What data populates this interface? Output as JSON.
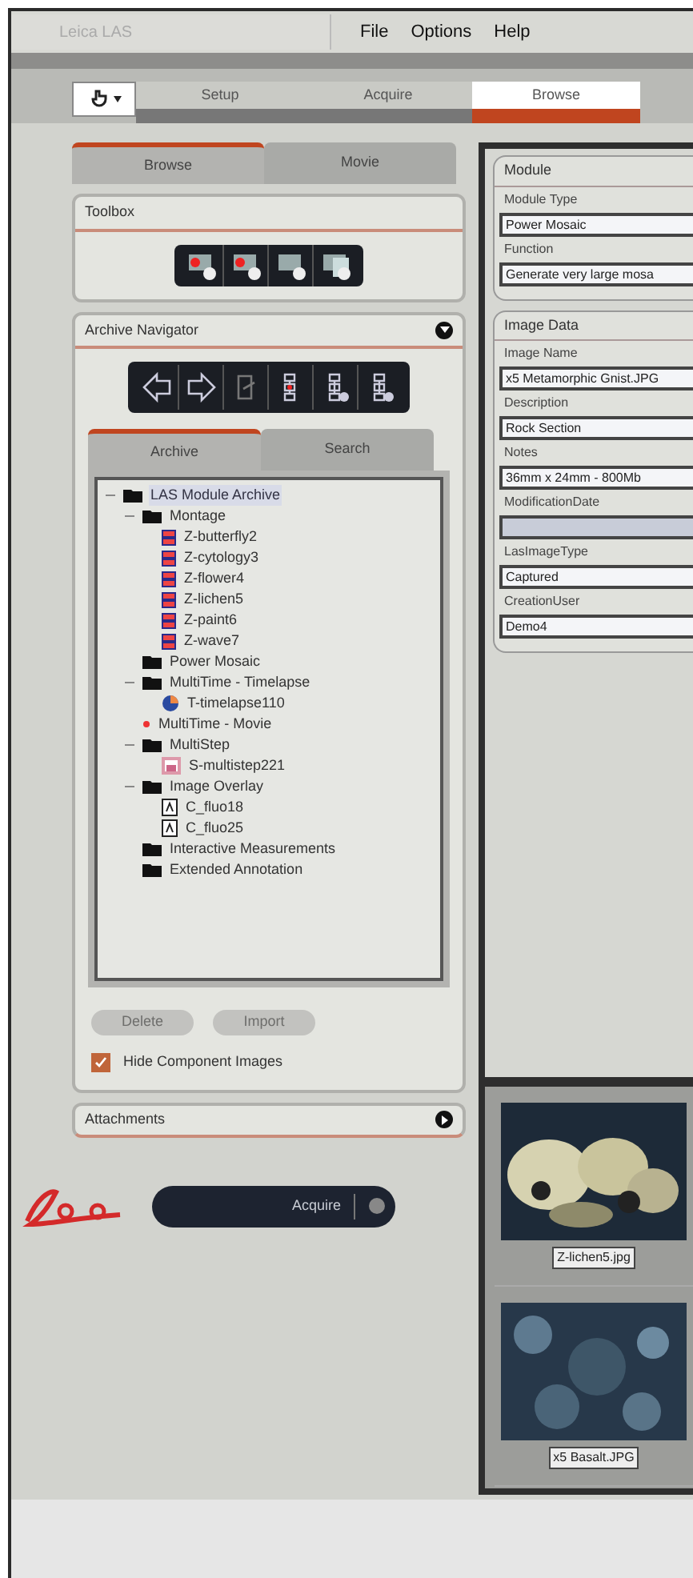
{
  "window": {
    "title": "Leica LAS",
    "menu": [
      "File",
      "Options",
      "Help"
    ]
  },
  "workflow_tabs": [
    {
      "label": "Setup",
      "selected": false
    },
    {
      "label": "Acquire",
      "selected": false
    },
    {
      "label": "Browse",
      "selected": true
    }
  ],
  "left_tabs": [
    {
      "label": "Browse",
      "selected": true
    },
    {
      "label": "Movie",
      "selected": false
    }
  ],
  "toolbox": {
    "title": "Toolbox"
  },
  "archive_navigator": {
    "title": "Archive Navigator",
    "expanded": true,
    "tabs": [
      {
        "label": "Archive",
        "selected": true
      },
      {
        "label": "Search",
        "selected": false
      }
    ],
    "tree": [
      {
        "label": "LAS Module Archive",
        "kind": "archive",
        "expanded": true,
        "selected": true,
        "children": [
          {
            "label": "Montage",
            "kind": "folder",
            "expanded": true,
            "selected": false,
            "children": [
              {
                "label": "Z-butterfly2",
                "kind": "montage",
                "selected": false
              },
              {
                "label": "Z-cytology3",
                "kind": "montage",
                "selected": false
              },
              {
                "label": "Z-flower4",
                "kind": "montage",
                "selected": false
              },
              {
                "label": "Z-lichen5",
                "kind": "montage",
                "selected": false
              },
              {
                "label": "Z-paint6",
                "kind": "montage",
                "selected": false
              },
              {
                "label": "Z-wave7",
                "kind": "montage",
                "selected": false
              }
            ]
          },
          {
            "label": "Power Mosaic",
            "kind": "folder",
            "selected": false
          },
          {
            "label": "MultiTime - Timelapse",
            "kind": "folder",
            "expanded": true,
            "selected": false,
            "children": [
              {
                "label": "T-timelapse110",
                "kind": "timelapse",
                "selected": false
              }
            ]
          },
          {
            "label": "MultiTime - Movie",
            "kind": "movie",
            "selected": false
          },
          {
            "label": "MultiStep",
            "kind": "folder",
            "expanded": true,
            "selected": false,
            "children": [
              {
                "label": "S-multistep221",
                "kind": "multistep",
                "selected": false
              }
            ]
          },
          {
            "label": "Image Overlay",
            "kind": "folder",
            "expanded": true,
            "selected": false,
            "children": [
              {
                "label": "C_fluo18",
                "kind": "overlay",
                "selected": false
              },
              {
                "label": "C_fluo25",
                "kind": "overlay",
                "selected": false
              }
            ]
          },
          {
            "label": "Interactive Measurements",
            "kind": "folder",
            "selected": false
          },
          {
            "label": "Extended Annotation",
            "kind": "folder",
            "selected": false
          }
        ]
      }
    ],
    "buttons": [
      {
        "label": "Delete",
        "disabled": true
      },
      {
        "label": "Import",
        "disabled": true
      }
    ],
    "hide_component_images": {
      "label": "Hide Component Images",
      "checked": true
    }
  },
  "attachments": {
    "title": "Attachments",
    "expanded": false
  },
  "acquire_button": {
    "label": "Acquire"
  },
  "module": {
    "title": "Module",
    "fields": [
      {
        "label": "Module Type",
        "value": "Power Mosaic"
      },
      {
        "label": "Function",
        "value": "Generate very large mosa"
      }
    ]
  },
  "image_data": {
    "title": "Image Data",
    "fields": [
      {
        "label": "Image Name",
        "value": "x5 Metamorphic Gnist.JPG",
        "disabled": false
      },
      {
        "label": "Description",
        "value": "Rock Section",
        "disabled": false
      },
      {
        "label": "Notes",
        "value": "36mm x 24mm - 800Mb",
        "disabled": false
      },
      {
        "label": "ModificationDate",
        "disabled": true
      },
      {
        "label": "LasImageType",
        "value": "Captured",
        "disabled": false
      },
      {
        "label": "CreationUser",
        "value": "Demo4",
        "disabled": false
      }
    ]
  },
  "thumbnails": [
    {
      "caption": "Z-lichen5.jpg",
      "kind": "picture"
    },
    {
      "caption": "x5 Basalt.JPG",
      "kind": "picture"
    }
  ]
}
